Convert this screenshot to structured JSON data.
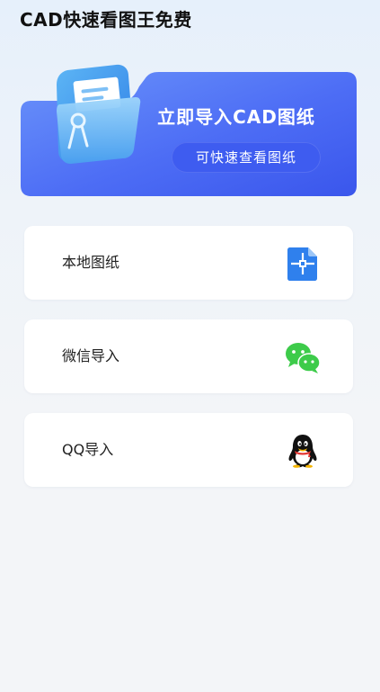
{
  "app": {
    "title": "CAD快速看图王免费"
  },
  "banner": {
    "headline": "立即导入CAD图纸",
    "subtitle": "可快速查看图纸",
    "icon": "folder-icon"
  },
  "options": [
    {
      "label": "本地图纸",
      "icon": "document-icon"
    },
    {
      "label": "微信导入",
      "icon": "wechat-icon"
    },
    {
      "label": "QQ导入",
      "icon": "qq-icon"
    }
  ],
  "colors": {
    "accent": "#4d6df5",
    "banner_gradient_start": "#5b83f8",
    "banner_gradient_end": "#3d5cf0",
    "wechat_green": "#3dcb4a",
    "document_blue": "#2f80ed"
  }
}
